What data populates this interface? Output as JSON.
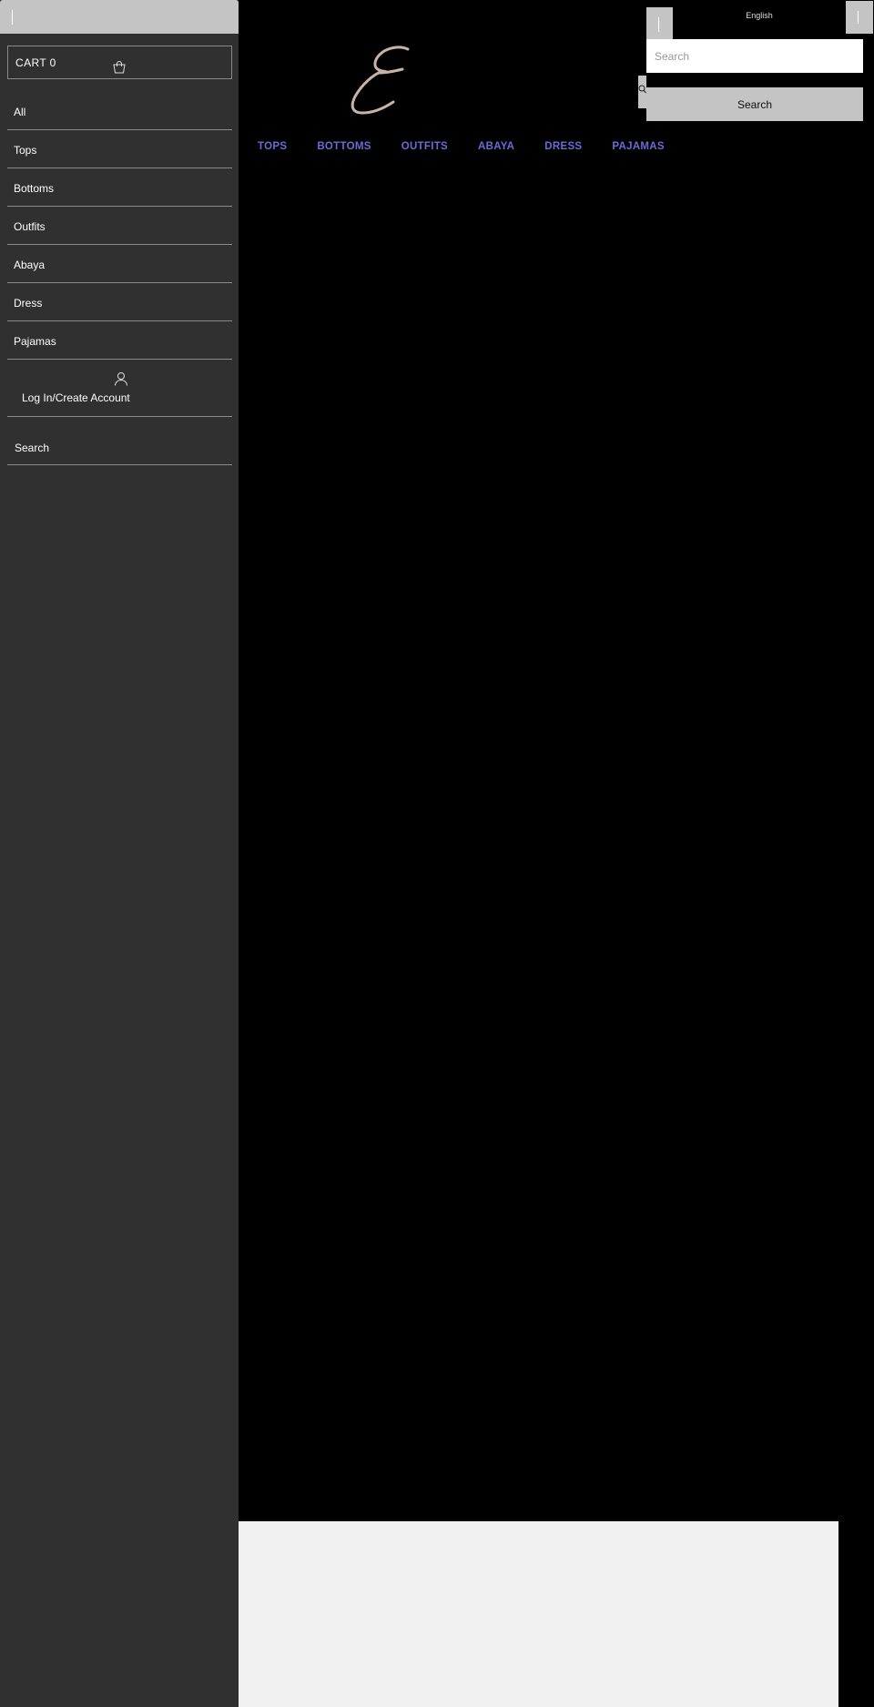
{
  "sidebar": {
    "cart_label": "CART 0",
    "cart_icon": "shopping-bag-icon",
    "nav_items": [
      {
        "label": "All"
      },
      {
        "label": "Tops"
      },
      {
        "label": "Bottoms"
      },
      {
        "label": "Outfits"
      },
      {
        "label": "Abaya"
      },
      {
        "label": "Dress"
      },
      {
        "label": "Pajamas"
      }
    ],
    "login_label": "Log In/Create Account",
    "login_icon": "user-icon",
    "search_label": "Search"
  },
  "header": {
    "logo_icon": "script-e-logo",
    "nav": [
      "TOPS",
      "BOTTOMS",
      "OUTFITS",
      "ABAYA",
      "DRESS",
      "PAJAMAS"
    ],
    "language": "English",
    "search_placeholder": "Search",
    "search_button": "Search"
  },
  "colors": {
    "background": "#000000",
    "sidebar": "#303030",
    "nav_link": "#6b6bd6",
    "button_gray": "#c4c4c4",
    "logo": "#c8b3a6",
    "footer": "#f0f0f0"
  }
}
